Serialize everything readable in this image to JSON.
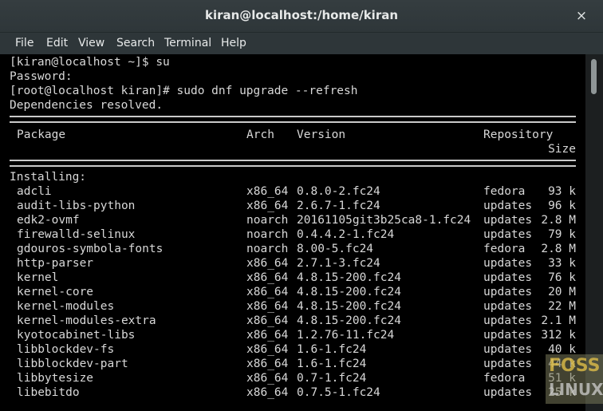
{
  "window": {
    "title": "kiran@localhost:/home/kiran",
    "close_label": "×"
  },
  "menu": [
    "File",
    "Edit",
    "View",
    "Search",
    "Terminal",
    "Help"
  ],
  "session": [
    "[kiran@localhost ~]$ su",
    "Password:",
    "[root@localhost kiran]# sudo dnf upgrade --refresh",
    "Dependencies resolved."
  ],
  "table": {
    "headers": {
      "package": "Package",
      "arch": "Arch",
      "version": "Version",
      "repository": "Repository",
      "size": "Size"
    },
    "section": "Installing:",
    "rows": [
      {
        "package": "adcli",
        "arch": "x86_64",
        "version": "0.8.0-2.fc24",
        "repo": "fedora",
        "size": "93 k"
      },
      {
        "package": "audit-libs-python",
        "arch": "x86_64",
        "version": "2.6.7-1.fc24",
        "repo": "updates",
        "size": "96 k"
      },
      {
        "package": "edk2-ovmf",
        "arch": "noarch",
        "version": "20161105git3b25ca8-1.fc24",
        "repo": "updates",
        "size": "2.8 M"
      },
      {
        "package": "firewalld-selinux",
        "arch": "noarch",
        "version": "0.4.4.2-1.fc24",
        "repo": "updates",
        "size": "79 k"
      },
      {
        "package": "gdouros-symbola-fonts",
        "arch": "noarch",
        "version": "8.00-5.fc24",
        "repo": "fedora",
        "size": "2.8 M"
      },
      {
        "package": "http-parser",
        "arch": "x86_64",
        "version": "2.7.1-3.fc24",
        "repo": "updates",
        "size": "33 k"
      },
      {
        "package": "kernel",
        "arch": "x86_64",
        "version": "4.8.15-200.fc24",
        "repo": "updates",
        "size": "76 k"
      },
      {
        "package": "kernel-core",
        "arch": "x86_64",
        "version": "4.8.15-200.fc24",
        "repo": "updates",
        "size": "20 M"
      },
      {
        "package": "kernel-modules",
        "arch": "x86_64",
        "version": "4.8.15-200.fc24",
        "repo": "updates",
        "size": "22 M"
      },
      {
        "package": "kernel-modules-extra",
        "arch": "x86_64",
        "version": "4.8.15-200.fc24",
        "repo": "updates",
        "size": "2.1 M"
      },
      {
        "package": "kyotocabinet-libs",
        "arch": "x86_64",
        "version": "1.2.76-11.fc24",
        "repo": "updates",
        "size": "312 k"
      },
      {
        "package": "libblockdev-fs",
        "arch": "x86_64",
        "version": "1.6-1.fc24",
        "repo": "updates",
        "size": "40 k"
      },
      {
        "package": "libblockdev-part",
        "arch": "x86_64",
        "version": "1.6-1.fc24",
        "repo": "updates",
        "size": "44 k"
      },
      {
        "package": "libbytesize",
        "arch": "x86_64",
        "version": "0.7-1.fc24",
        "repo": "fedora",
        "size": "51 k"
      },
      {
        "package": "libebitdo",
        "arch": "x86_64",
        "version": "0.7.5-1.fc24",
        "repo": "updates",
        "size": "25 k"
      }
    ]
  },
  "watermark": {
    "line1": "FOSS",
    "line2": "LINUX"
  }
}
